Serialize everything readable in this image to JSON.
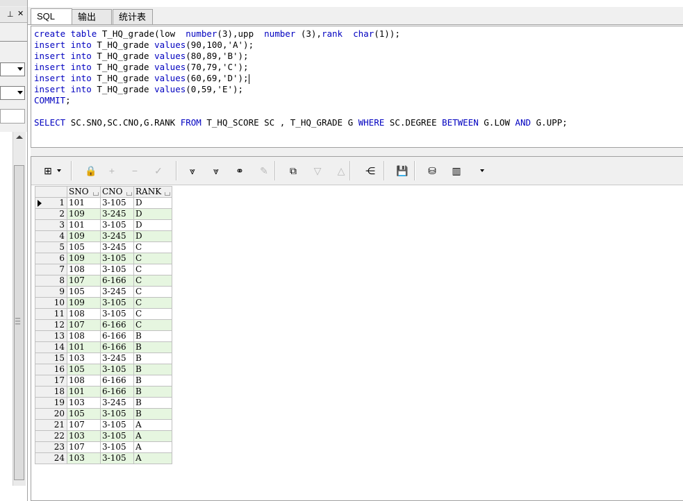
{
  "tabs": [
    {
      "label": "SQL",
      "active": true
    },
    {
      "label": "输出",
      "active": false
    },
    {
      "label": "统计表",
      "active": false
    }
  ],
  "left_panel": {
    "pin_icon": "pin-icon",
    "close_label": "✕"
  },
  "editor": {
    "lines": [
      [
        {
          "t": "create table ",
          "k": true
        },
        {
          "t": "T_HQ_grade(low  ",
          "k": false
        },
        {
          "t": "number",
          "k": true
        },
        {
          "t": "(3),upp  ",
          "k": false
        },
        {
          "t": "number",
          "k": true
        },
        {
          "t": " (3),",
          "k": false
        },
        {
          "t": "rank",
          "k": true
        },
        {
          "t": "  ",
          "k": false
        },
        {
          "t": "char",
          "k": true
        },
        {
          "t": "(1));",
          "k": false
        }
      ],
      [
        {
          "t": "insert into ",
          "k": true
        },
        {
          "t": "T_HQ_grade ",
          "k": false
        },
        {
          "t": "values",
          "k": true
        },
        {
          "t": "(90,100,'A');",
          "k": false
        }
      ],
      [
        {
          "t": "insert into ",
          "k": true
        },
        {
          "t": "T_HQ_grade ",
          "k": false
        },
        {
          "t": "values",
          "k": true
        },
        {
          "t": "(80,89,'B');",
          "k": false
        }
      ],
      [
        {
          "t": "insert into ",
          "k": true
        },
        {
          "t": "T_HQ_grade ",
          "k": false
        },
        {
          "t": "values",
          "k": true
        },
        {
          "t": "(70,79,'C');",
          "k": false
        }
      ],
      [
        {
          "t": "insert into ",
          "k": true
        },
        {
          "t": "T_HQ_grade ",
          "k": false
        },
        {
          "t": "values",
          "k": true
        },
        {
          "t": "(60,69,'D');",
          "k": false
        }
      ],
      [
        {
          "t": "insert into ",
          "k": true
        },
        {
          "t": "T_HQ_grade ",
          "k": false
        },
        {
          "t": "values",
          "k": true
        },
        {
          "t": "(0,59,'E');",
          "k": false
        }
      ],
      [
        {
          "t": "COMMIT",
          "k": true
        },
        {
          "t": ";",
          "k": false
        }
      ],
      [],
      [
        {
          "t": "SELECT ",
          "k": true
        },
        {
          "t": "SC.SNO,SC.CNO,G.RANK ",
          "k": false
        },
        {
          "t": "FROM ",
          "k": true
        },
        {
          "t": "T_HQ_SCORE SC , T_HQ_GRADE G ",
          "k": false
        },
        {
          "t": "WHERE ",
          "k": true
        },
        {
          "t": "SC.DEGREE ",
          "k": false
        },
        {
          "t": "BETWEEN ",
          "k": true
        },
        {
          "t": "G.LOW ",
          "k": false
        },
        {
          "t": "AND ",
          "k": true
        },
        {
          "t": "G.UPP;",
          "k": false
        }
      ]
    ],
    "cursor_line": 4,
    "keyword_color": "#0000c0"
  },
  "toolbar": {
    "items": [
      {
        "name": "grid-view-icon",
        "glyph": "⊞",
        "enabled": true
      },
      {
        "name": "lock-icon",
        "glyph": "🔒",
        "enabled": true
      },
      {
        "name": "add-record-icon",
        "glyph": "+",
        "enabled": false
      },
      {
        "name": "delete-record-icon",
        "glyph": "−",
        "enabled": false
      },
      {
        "name": "post-changes-icon",
        "glyph": "✓",
        "enabled": false
      },
      {
        "name": "fetch-next-icon",
        "glyph": "⩔",
        "enabled": true
      },
      {
        "name": "fetch-last-icon",
        "glyph": "⩔",
        "enabled": true
      },
      {
        "name": "find-binoculars-icon",
        "glyph": "⚭",
        "enabled": true
      },
      {
        "name": "clear-icon",
        "glyph": "✎",
        "enabled": false
      },
      {
        "name": "query-by-example-icon",
        "glyph": "⧉",
        "enabled": true
      },
      {
        "name": "sort-desc-icon",
        "glyph": "▽",
        "enabled": false
      },
      {
        "name": "sort-asc-icon",
        "glyph": "△",
        "enabled": false
      },
      {
        "name": "export-tree-icon",
        "glyph": "⋲",
        "enabled": true
      },
      {
        "name": "save-icon",
        "glyph": "💾",
        "enabled": true
      },
      {
        "name": "database-icon",
        "glyph": "⛁",
        "enabled": true
      },
      {
        "name": "chart-icon",
        "glyph": "▥",
        "enabled": true
      }
    ]
  },
  "grid": {
    "columns": [
      "",
      "SNO",
      "CNO",
      "RANK"
    ],
    "current_row": 1,
    "alt_row_color": "#e6f6e0",
    "rows": [
      [
        "1",
        "101",
        "3-105",
        "D"
      ],
      [
        "2",
        "109",
        "3-245",
        "D"
      ],
      [
        "3",
        "101",
        "3-105",
        "D"
      ],
      [
        "4",
        "109",
        "3-245",
        "D"
      ],
      [
        "5",
        "105",
        "3-245",
        "C"
      ],
      [
        "6",
        "109",
        "3-105",
        "C"
      ],
      [
        "7",
        "108",
        "3-105",
        "C"
      ],
      [
        "8",
        "107",
        "6-166",
        "C"
      ],
      [
        "9",
        "105",
        "3-245",
        "C"
      ],
      [
        "10",
        "109",
        "3-105",
        "C"
      ],
      [
        "11",
        "108",
        "3-105",
        "C"
      ],
      [
        "12",
        "107",
        "6-166",
        "C"
      ],
      [
        "13",
        "108",
        "6-166",
        "B"
      ],
      [
        "14",
        "101",
        "6-166",
        "B"
      ],
      [
        "15",
        "103",
        "3-245",
        "B"
      ],
      [
        "16",
        "105",
        "3-105",
        "B"
      ],
      [
        "17",
        "108",
        "6-166",
        "B"
      ],
      [
        "18",
        "101",
        "6-166",
        "B"
      ],
      [
        "19",
        "103",
        "3-245",
        "B"
      ],
      [
        "20",
        "105",
        "3-105",
        "B"
      ],
      [
        "21",
        "107",
        "3-105",
        "A"
      ],
      [
        "22",
        "103",
        "3-105",
        "A"
      ],
      [
        "23",
        "107",
        "3-105",
        "A"
      ],
      [
        "24",
        "103",
        "3-105",
        "A"
      ]
    ]
  }
}
